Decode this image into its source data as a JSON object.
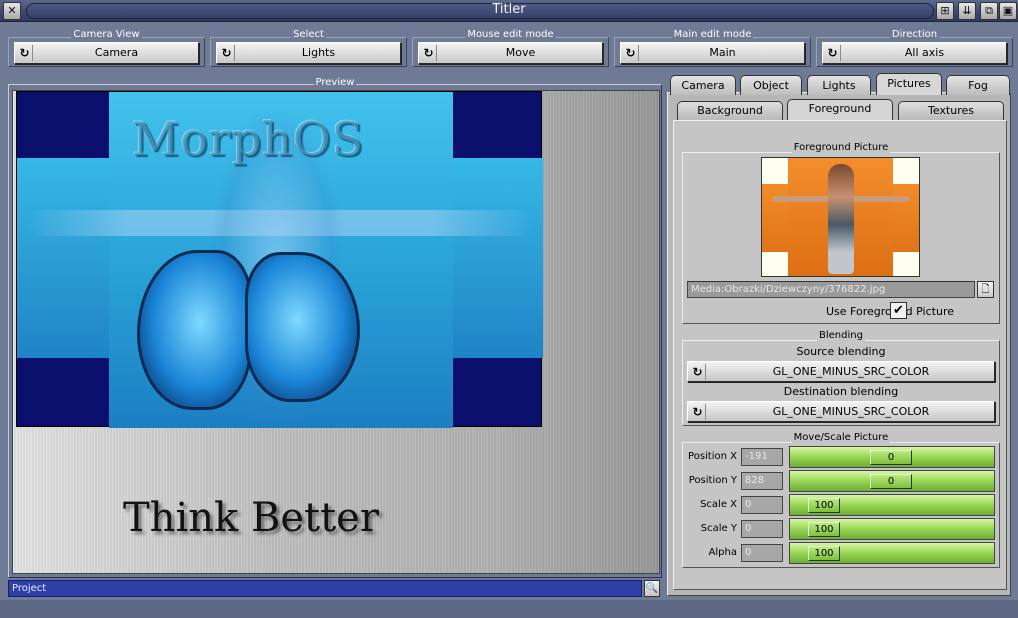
{
  "window": {
    "title": "Titler",
    "buttons": {
      "close": "✕",
      "iconify": "⊞",
      "snapshot": "⇊",
      "depth": "⧉",
      "zoom": "▣"
    }
  },
  "toolbar": {
    "groups": [
      {
        "label": "Camera View",
        "value": "Camera"
      },
      {
        "label": "Select",
        "value": "Lights"
      },
      {
        "label": "Mouse edit mode",
        "value": "Move"
      },
      {
        "label": "Main edit mode",
        "value": "Main"
      },
      {
        "label": "Direction",
        "value": "All axis"
      }
    ]
  },
  "preview": {
    "label": "Preview",
    "overlay_title": "MorphOS",
    "tagline": "Think Better"
  },
  "project": {
    "label": "Project",
    "button": "🔍"
  },
  "tabs": [
    {
      "label": "Camera",
      "active": false
    },
    {
      "label": "Object",
      "active": false
    },
    {
      "label": "Lights",
      "active": false
    },
    {
      "label": "Pictures",
      "active": true
    },
    {
      "label": "Fog",
      "active": false
    }
  ],
  "subtabs": [
    {
      "label": "Background",
      "active": false
    },
    {
      "label": "Foreground",
      "active": true
    },
    {
      "label": "Textures",
      "active": false
    }
  ],
  "foreground": {
    "group_title": "Foreground Picture",
    "path": "Media:Obrazki/Dziewczyny/376822.jpg",
    "use_label": "Use Foreground Picture",
    "use_checked": "✔"
  },
  "blending": {
    "group_title": "Blending",
    "source_label": "Source blending",
    "source_value": "GL_ONE_MINUS_SRC_COLOR",
    "dest_label": "Destination blending",
    "dest_value": "GL_ONE_MINUS_SRC_COLOR"
  },
  "move_scale": {
    "group_title": "Move/Scale Picture",
    "rows": [
      {
        "label": "Position X",
        "field": "-191",
        "slider": "0"
      },
      {
        "label": "Position Y",
        "field": "828",
        "slider": "0"
      },
      {
        "label": "Scale X",
        "field": "0",
        "slider": "100"
      },
      {
        "label": "Scale Y",
        "field": "0",
        "slider": "100"
      },
      {
        "label": "Alpha",
        "field": "0",
        "slider": "100"
      }
    ]
  },
  "colors": {
    "accent": "#6f7a94",
    "slider_green": "#86c546",
    "project_bar": "#2f3fa8"
  }
}
